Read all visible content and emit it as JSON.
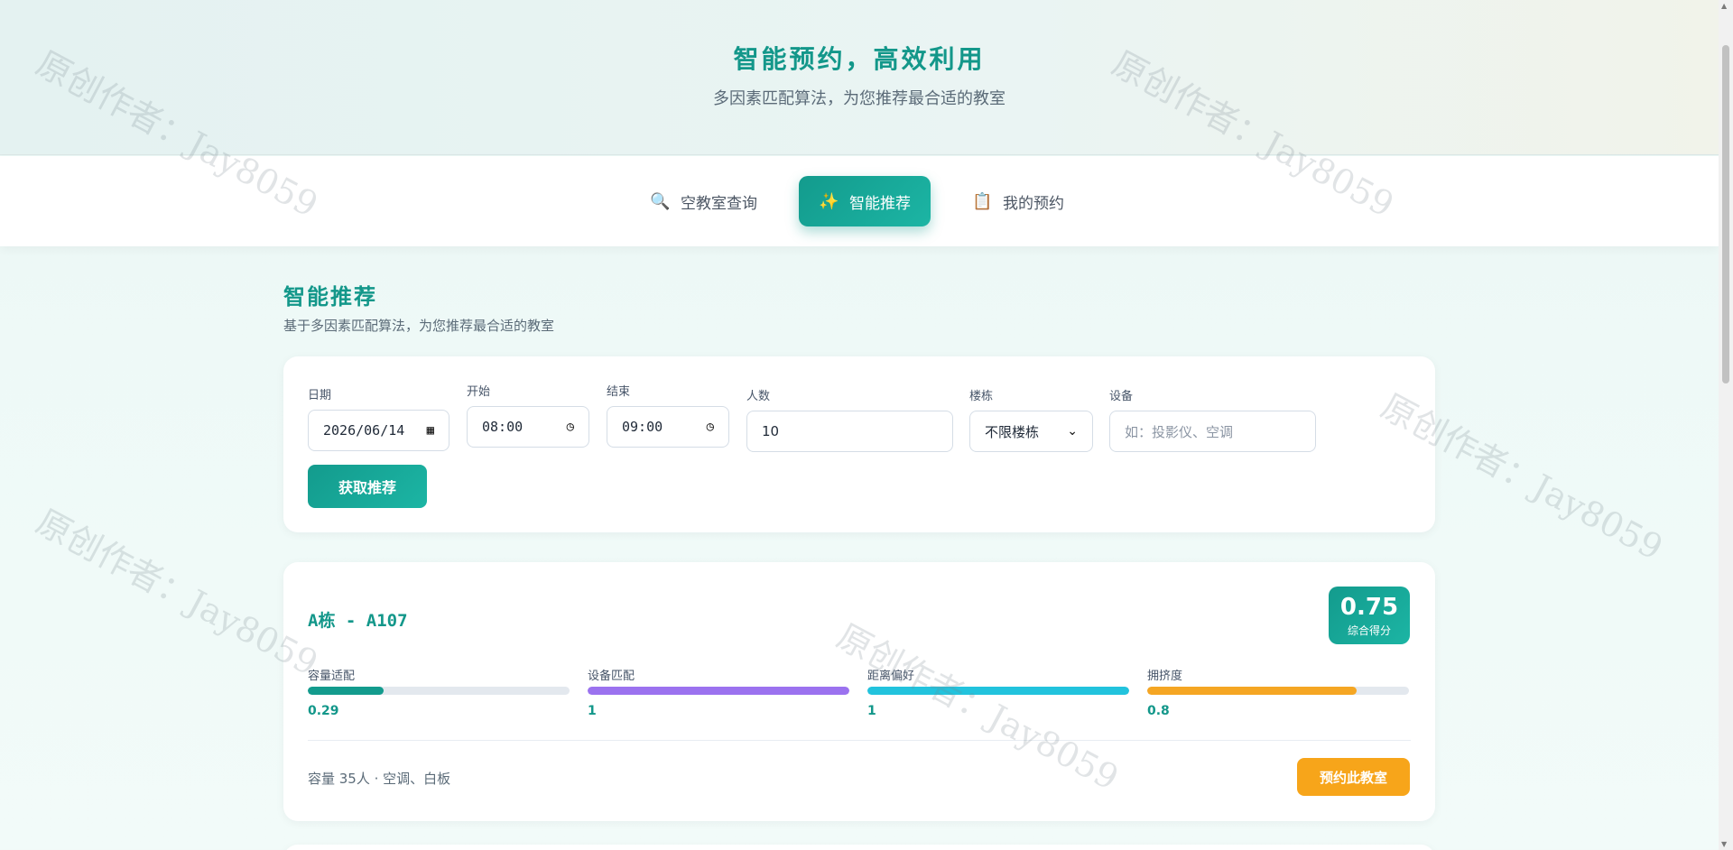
{
  "header": {
    "title": "智能预约，高效利用",
    "subtitle": "多因素匹配算法，为您推荐最合适的教室"
  },
  "nav": {
    "tabs": [
      {
        "label": "空教室查询",
        "icon": "magnifier-icon",
        "glyph": "🔍",
        "active": false
      },
      {
        "label": "智能推荐",
        "icon": "sparkles-icon",
        "glyph": "✨",
        "active": true
      },
      {
        "label": "我的预约",
        "icon": "clipboard-icon",
        "glyph": "📋",
        "active": false
      }
    ]
  },
  "section": {
    "title": "智能推荐",
    "subtitle": "基于多因素匹配算法，为您推荐最合适的教室"
  },
  "form": {
    "date": {
      "label": "日期",
      "value": "2026/06/14"
    },
    "start": {
      "label": "开始",
      "value": "08:00"
    },
    "end": {
      "label": "结束",
      "value": "09:00"
    },
    "people": {
      "label": "人数",
      "value": "10"
    },
    "building": {
      "label": "楼栋",
      "value": "不限楼栋"
    },
    "equipment": {
      "label": "设备",
      "placeholder": "如：投影仪、空调"
    },
    "submit_label": "获取推荐"
  },
  "result": {
    "room": "A栋 - A107",
    "score": "0.75",
    "score_label": "综合得分",
    "metrics": [
      {
        "label": "容量适配",
        "value": "0.29",
        "fraction": 0.29,
        "color": "#139b8d"
      },
      {
        "label": "设备匹配",
        "value": "1",
        "fraction": 1.0,
        "color": "#9b72ef"
      },
      {
        "label": "距离偏好",
        "value": "1",
        "fraction": 1.0,
        "color": "#22c3dd"
      },
      {
        "label": "拥挤度",
        "value": "0.8",
        "fraction": 0.8,
        "color": "#f5a623"
      }
    ],
    "info": "容量 35人 · 空调、白板",
    "book_label": "预约此教室"
  },
  "watermark": "原创作者：Jay8059"
}
